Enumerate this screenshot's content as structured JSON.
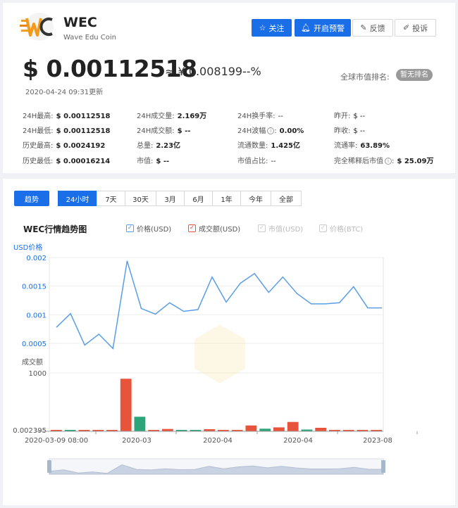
{
  "header": {
    "symbol": "WEC",
    "name": "Wave Edu Coin",
    "buttons": {
      "follow": "关注",
      "alert": "开启预警",
      "feedback": "反馈",
      "complain": "投诉"
    }
  },
  "price": {
    "usd": "$ 0.00112518",
    "cny": "≈ ¥ 0.008199",
    "change": "--%",
    "updated": "2020-04-24 09:31更新",
    "rank_label": "全球市值排名:",
    "rank_value": "暂无排名"
  },
  "stats": {
    "high_24h": {
      "label": "24H最高:",
      "value": "$ 0.00112518"
    },
    "low_24h": {
      "label": "24H最低:",
      "value": "$ 0.00112518"
    },
    "ath": {
      "label": "历史最高:",
      "value": "$ 0.0024192"
    },
    "atl": {
      "label": "历史最低:",
      "value": "$ 0.00016214"
    },
    "volume_24h": {
      "label": "24H成交量:",
      "value": "2.169万"
    },
    "turnover_24h": {
      "label": "24H成交额:",
      "value": "$ --"
    },
    "supply_total": {
      "label": "总量:",
      "value": "2.23亿"
    },
    "market_cap": {
      "label": "市值:",
      "value": "$ --"
    },
    "turnover_rate_24h": {
      "label": "24H换手率:",
      "value": "--"
    },
    "amplitude_24h": {
      "label": "24H波幅",
      "value": "0.00%"
    },
    "circulating": {
      "label": "流通数量:",
      "value": "1.425亿"
    },
    "mcap_share": {
      "label": "市值占比:",
      "value": "--"
    },
    "open_yday": {
      "label": "昨开:",
      "value": "$ --"
    },
    "close_yday": {
      "label": "昨收:",
      "value": "$ --"
    },
    "circ_rate": {
      "label": "流通率:",
      "value": "63.89%"
    },
    "fdv": {
      "label": "完全稀释后市值",
      "value": "$ 25.09万"
    }
  },
  "tabs": {
    "trend": "趋势",
    "ranges": [
      "24小时",
      "7天",
      "30天",
      "3月",
      "6月",
      "1年",
      "今年",
      "全部"
    ],
    "active_range": "24小时"
  },
  "chart_header": {
    "title": "WEC行情趋势图",
    "legend": [
      {
        "label": "价格(USD)",
        "checked": true,
        "color": "#5b9ee6"
      },
      {
        "label": "成交额(USD)",
        "checked": true,
        "color": "#e8533b"
      },
      {
        "label": "市值(USD)",
        "checked": false,
        "color": "#cccccc"
      },
      {
        "label": "价格(BTC)",
        "checked": false,
        "color": "#cccccc"
      }
    ]
  },
  "chart_data": {
    "type": "line",
    "price_axis_title": "USD价格",
    "volume_axis_title": "成交额",
    "price_ticks": [
      "0.002",
      "0.0015",
      "0.001",
      "0.0005"
    ],
    "volume_ticks": [
      "1000",
      "0.002395"
    ],
    "x_labels": [
      "2020-03-09 08:00",
      "2020-03",
      "2020-04",
      "2020-04",
      "2023-08"
    ],
    "price_ylim": [
      0.0005,
      0.002
    ],
    "volume_ylim": [
      0.002395,
      1000
    ],
    "price_series": {
      "name": "价格(USD)",
      "color": "#5b9ee6",
      "values": [
        0.00078,
        0.00102,
        0.00047,
        0.00066,
        0.00041,
        0.00194,
        0.00111,
        0.00101,
        0.00121,
        0.00106,
        0.00109,
        0.00166,
        0.00122,
        0.00155,
        0.00172,
        0.00139,
        0.00166,
        0.00137,
        0.00119,
        0.00119,
        0.00121,
        0.00149,
        0.00112,
        0.00112
      ]
    },
    "volume_series": {
      "name": "成交额(USD)",
      "up_color": "#2ca57a",
      "down_color": "#e8533b",
      "bars": [
        {
          "value": 12,
          "dir": "down"
        },
        {
          "value": 12,
          "dir": "up"
        },
        {
          "value": 20,
          "dir": "down"
        },
        {
          "value": 0,
          "dir": "down"
        },
        {
          "value": 15,
          "dir": "down"
        },
        {
          "value": 900,
          "dir": "down"
        },
        {
          "value": 250,
          "dir": "up"
        },
        {
          "value": 0,
          "dir": "down"
        },
        {
          "value": 40,
          "dir": "down"
        },
        {
          "value": 22,
          "dir": "up"
        },
        {
          "value": 22,
          "dir": "up"
        },
        {
          "value": 36,
          "dir": "down"
        },
        {
          "value": 0,
          "dir": "down"
        },
        {
          "value": 20,
          "dir": "down"
        },
        {
          "value": 100,
          "dir": "down"
        },
        {
          "value": 45,
          "dir": "up"
        },
        {
          "value": 68,
          "dir": "down"
        },
        {
          "value": 160,
          "dir": "down"
        },
        {
          "value": 30,
          "dir": "up"
        },
        {
          "value": 60,
          "dir": "down"
        },
        {
          "value": 0,
          "dir": "down"
        },
        {
          "value": 0,
          "dir": "down"
        },
        {
          "value": 0,
          "dir": "down"
        },
        {
          "value": 18,
          "dir": "down"
        }
      ]
    },
    "grid": true
  }
}
